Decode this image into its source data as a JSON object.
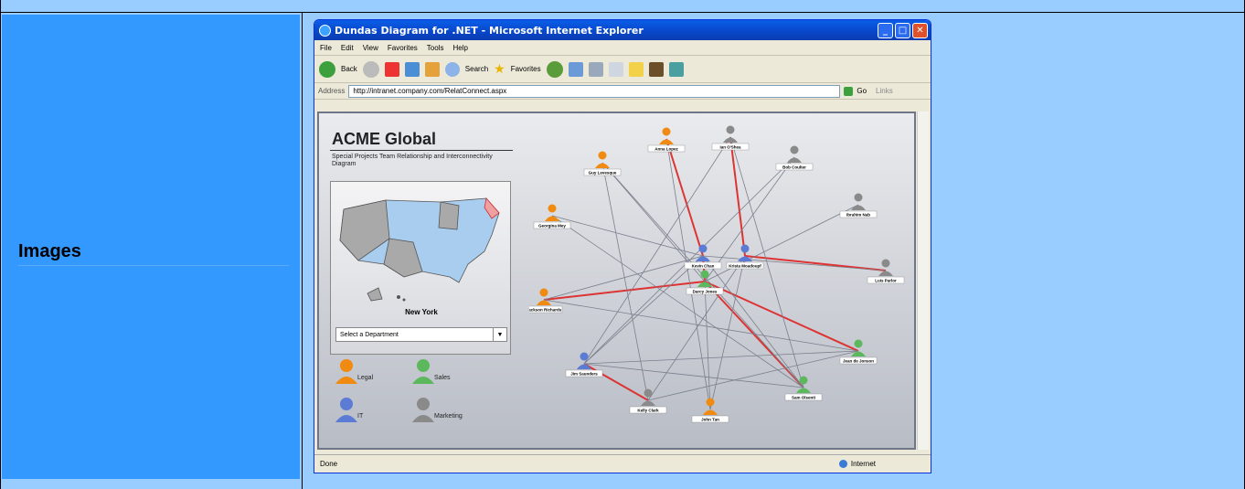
{
  "row_label": "Images",
  "browser": {
    "title": "Dundas Diagram for .NET - Microsoft Internet Explorer",
    "menu": [
      "File",
      "Edit",
      "View",
      "Favorites",
      "Tools",
      "Help"
    ],
    "toolbar": {
      "back": "Back",
      "search": "Search",
      "favorites": "Favorites"
    },
    "address_label": "Address",
    "url": "http://intranet.company.com/RelatConnect.aspx",
    "go": "Go",
    "links": "Links",
    "status": "Done",
    "zone": "Internet"
  },
  "app": {
    "title": "ACME Global",
    "subtitle": "Special Projects Team Relationship and Interconnectivity Diagram",
    "selected_state": "New York",
    "department_select": "Select a Department",
    "legend": [
      {
        "label": "Legal",
        "color": "#f08a10"
      },
      {
        "label": "Sales",
        "color": "#5cb85c"
      },
      {
        "label": "IT",
        "color": "#5b7bd5"
      },
      {
        "label": "Marketing",
        "color": "#8a8a8a"
      }
    ],
    "people": [
      {
        "name": "Anna Lopez",
        "color": "#f08a10"
      },
      {
        "name": "Ian O'Shea",
        "color": "#8a8a8a"
      },
      {
        "name": "Bob Coulter",
        "color": "#8a8a8a"
      },
      {
        "name": "Guy Levesque",
        "color": "#f08a10"
      },
      {
        "name": "Ibrahim Nab",
        "color": "#8a8a8a"
      },
      {
        "name": "Georgina Mey",
        "color": "#f08a10"
      },
      {
        "name": "Kevin Chan",
        "color": "#5b7bd5"
      },
      {
        "name": "Krista Moadoupf",
        "color": "#5b7bd5"
      },
      {
        "name": "Luis Parlor",
        "color": "#8a8a8a"
      },
      {
        "name": "Jackson Richards",
        "color": "#f08a10"
      },
      {
        "name": "Darcy Jones",
        "color": "#5cb85c"
      },
      {
        "name": "Jean de Jonson",
        "color": "#5cb85c"
      },
      {
        "name": "Jim Saunders",
        "color": "#5b7bd5"
      },
      {
        "name": "Sam Olsenti",
        "color": "#5cb85c"
      },
      {
        "name": "Kelly Clark",
        "color": "#8a8a8a"
      },
      {
        "name": "John Tan",
        "color": "#f08a10"
      }
    ]
  }
}
